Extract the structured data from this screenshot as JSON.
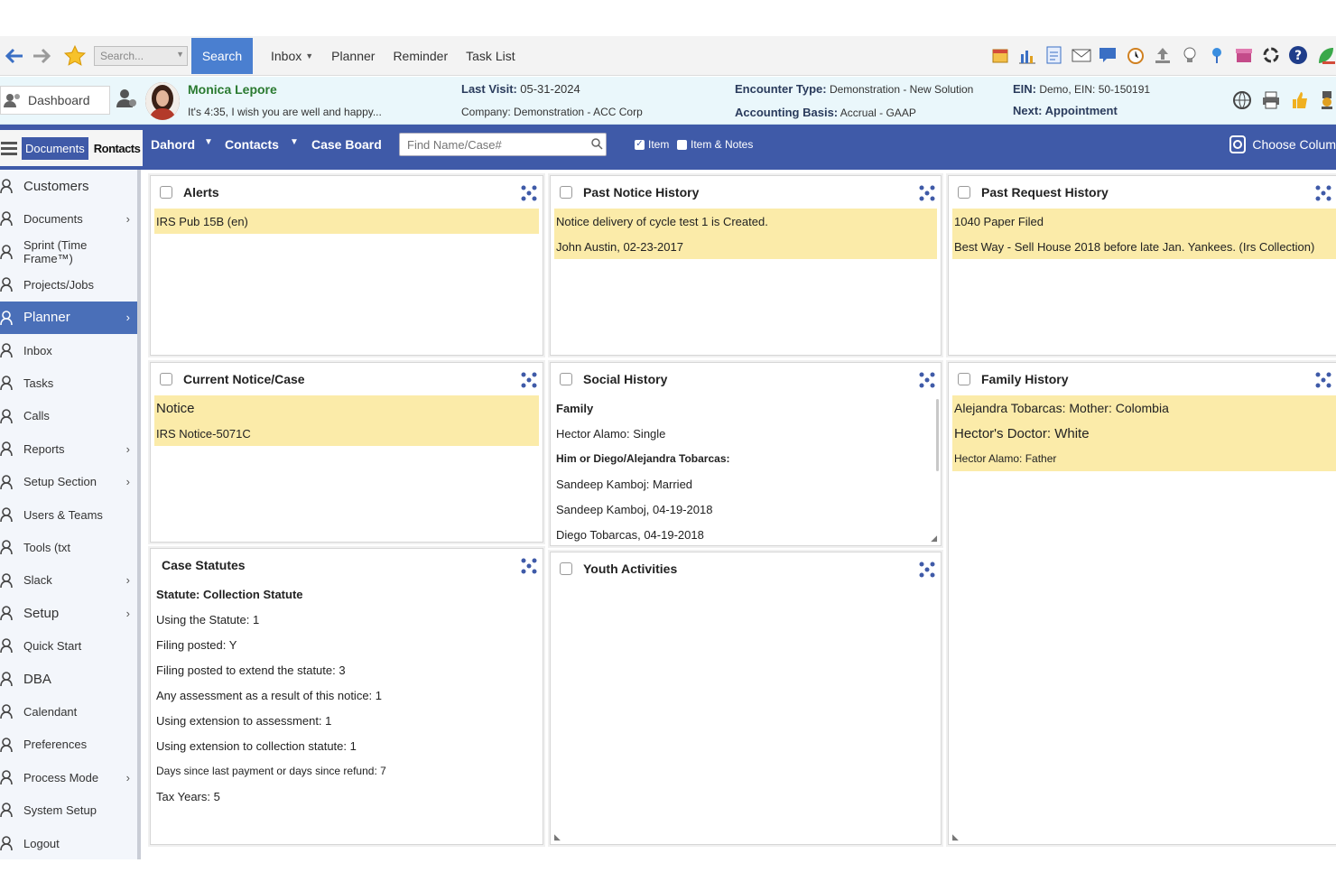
{
  "toolbar": {
    "search_placeholder": "Search...",
    "search_button": "Search",
    "links": [
      {
        "label": "Inbox",
        "dropdown": true
      },
      {
        "label": "Planner",
        "dropdown": false
      },
      {
        "label": "Reminder",
        "dropdown": false
      },
      {
        "label": "Task List",
        "dropdown": false
      }
    ],
    "icons": [
      "calendar-icon",
      "bar-chart-icon",
      "report-icon",
      "mail-icon",
      "chat-icon",
      "alarm-clock-icon",
      "upload-icon",
      "lightbulb-icon",
      "pin-icon",
      "store-icon",
      "sync-icon",
      "help-icon",
      "leaf-icon"
    ]
  },
  "client": {
    "dashboard_label": "Dashboard",
    "name": "Monica Lepore",
    "greeting": "It's 4:35, I wish you are well and happy...",
    "last_visit_label": "Last Visit:",
    "last_visit_value": "05-31-2024",
    "company": "Company: Demonstration - ACC Corp",
    "encounter_label": "Encounter Type:",
    "encounter_value": "Demonstration - New Solution",
    "accounting_label": "Accounting Basis:",
    "accounting_value": "Accrual - GAAP",
    "ein_label": "EIN:",
    "ein_value": "Demo, EIN: 50-150191",
    "next_label": "Next: Appointment"
  },
  "subnav": {
    "tab_documents": "Documents",
    "tab_contacts": "Rontacts",
    "dashboard": "Dahord",
    "contacts": "Contacts",
    "case_board": "Case Board",
    "find_placeholder": "Find Name/Case#",
    "chk_item": "Item",
    "chk_item_notes": "Item & Notes",
    "choose_columns": "Choose Colum"
  },
  "sidebar": [
    {
      "label": "Customers",
      "icon": "customers-icon",
      "chev": false,
      "big": true
    },
    {
      "label": "Documents",
      "icon": "documents-icon",
      "chev": true,
      "big": false
    },
    {
      "label": "Sprint (Time Frame™)",
      "icon": "sprint-icon",
      "chev": false,
      "big": false
    },
    {
      "label": "Projects/Jobs",
      "icon": "projects-icon",
      "chev": false,
      "big": false
    },
    {
      "label": "Planner",
      "icon": "planner-icon",
      "chev": true,
      "big": true,
      "active": true
    },
    {
      "label": "Inbox",
      "icon": "inbox-icon",
      "chev": false,
      "big": false
    },
    {
      "label": "Tasks",
      "icon": "tasks-icon",
      "chev": false,
      "big": false
    },
    {
      "label": "Calls",
      "icon": "calls-icon",
      "chev": false,
      "big": false
    },
    {
      "label": "Reports",
      "icon": "reports-icon",
      "chev": true,
      "big": false
    },
    {
      "label": "Setup Section",
      "icon": "setup-section-icon",
      "chev": true,
      "big": false
    },
    {
      "label": "Users & Teams",
      "icon": "users-icon",
      "chev": false,
      "big": false
    },
    {
      "label": "Tools (txt",
      "icon": "tools-icon",
      "chev": false,
      "big": false
    },
    {
      "label": "Slack",
      "icon": "slack-icon",
      "chev": true,
      "big": false
    },
    {
      "label": "Setup",
      "icon": "setup-icon",
      "chev": true,
      "big": true
    },
    {
      "label": "Quick Start",
      "icon": "quick-start-icon",
      "chev": false,
      "big": false
    },
    {
      "label": "DBA",
      "icon": "dba-icon",
      "chev": false,
      "big": true
    },
    {
      "label": "Calendant",
      "icon": "calendar-icon",
      "chev": false,
      "big": false
    },
    {
      "label": "Preferences",
      "icon": "preferences-icon",
      "chev": false,
      "big": false
    },
    {
      "label": "Process Mode",
      "icon": "process-mode-icon",
      "chev": true,
      "big": false
    },
    {
      "label": "System Setup",
      "icon": "system-setup-icon",
      "chev": false,
      "big": false
    },
    {
      "label": "Logout",
      "icon": "logout-icon",
      "chev": false,
      "big": false
    }
  ],
  "panels": {
    "alerts": {
      "title": "Alerts",
      "rows": [
        "IRS Pub 15B (en)"
      ]
    },
    "past_notice": {
      "title": "Past Notice History",
      "rows": [
        "Notice delivery of cycle test 1 is Created.",
        "John Austin, 02-23-2017"
      ]
    },
    "past_request": {
      "title": "Past Request History",
      "rows": [
        "1040 Paper Filed",
        "Best Way - Sell House 2018 before late Jan. Yankees. (Irs Collection)"
      ]
    },
    "current_notice": {
      "title": "Current Notice/Case",
      "rows": [
        "Notice",
        "IRS Notice-5071C"
      ]
    },
    "social": {
      "title": "Social History",
      "rows": [
        "Family",
        "Hector Alamo:  Single",
        "Him or Diego/Alejandra Tobarcas:",
        "Sandeep Kamboj: Married",
        "Sandeep Kamboj, 04-19-2018",
        "Diego Tobarcas, 04-19-2018"
      ]
    },
    "family": {
      "title": "Family History",
      "rows": [
        "Alejandra Tobarcas:  Mother:  Colombia",
        "Hector's Doctor:  White",
        "Hector Alamo: Father"
      ]
    },
    "case_statutes": {
      "title": "Case Statutes",
      "rows": [
        "Statute: Collection Statute",
        "Using the Statute: 1",
        "Filing posted: Y",
        "Filing posted to extend the statute: 3",
        "Any assessment as a result of this notice: 1",
        "Using extension to assessment: 1",
        "Using extension to collection statute: 1",
        "Days since last payment or days since refund: 7",
        "Tax Years: 5"
      ]
    },
    "youth": {
      "title": "Youth Activities",
      "rows": []
    }
  }
}
